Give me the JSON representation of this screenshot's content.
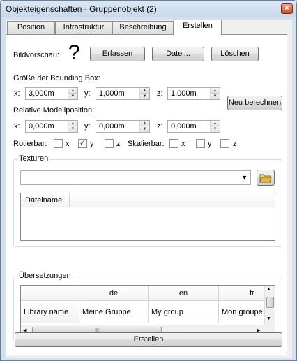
{
  "window": {
    "title": "Objekteigenschaften - Gruppenobjekt (2)",
    "close_glyph": "×"
  },
  "tabs": [
    {
      "label": "Position"
    },
    {
      "label": "Infrastruktur"
    },
    {
      "label": "Beschreibung"
    },
    {
      "label": "Erstellen",
      "active": true
    }
  ],
  "preview": {
    "label": "Bildvorschau:",
    "placeholder_glyph": "?",
    "capture_button": "Erfassen",
    "file_button": "Datei...",
    "delete_button": "Löschen"
  },
  "bounding_box": {
    "label": "Größe der Bounding Box:",
    "x_label": "x:",
    "x_value": "3,000m",
    "y_label": "y:",
    "y_value": "1,000m",
    "z_label": "z:",
    "z_value": "1,000m",
    "recalc_button": "Neu berechnen"
  },
  "model_position": {
    "label": "Relative Modellposition:",
    "x_label": "x:",
    "x_value": "0,000m",
    "y_label": "y:",
    "y_value": "0,000m",
    "z_label": "z:",
    "z_value": "0,000m"
  },
  "rotation": {
    "label": "Rotierbar:",
    "x": {
      "label": "x",
      "checked": false
    },
    "y": {
      "label": "y",
      "checked": true
    },
    "z": {
      "label": "z",
      "checked": false
    }
  },
  "scaling": {
    "label": "Skalierbar:",
    "x": {
      "label": "x",
      "checked": false
    },
    "y": {
      "label": "y",
      "checked": false
    },
    "z": {
      "label": "z",
      "checked": false
    }
  },
  "check_glyph": "✓",
  "textures": {
    "group_title": "Texturen",
    "combo_value": "",
    "dropdown_glyph": "▼",
    "columns": [
      "Dateiname"
    ]
  },
  "translations": {
    "group_title": "Übersetzungen",
    "columns": [
      "",
      "de",
      "en",
      "fr"
    ],
    "rows": [
      [
        "Library name",
        "Meine Gruppe",
        "My group",
        "Mon groupe"
      ]
    ],
    "scroll_thumb_glyph": "III"
  },
  "create_button": "Erstellen",
  "colors": {
    "title_bar": "#c8d7ea",
    "close_button": "#c74a2b",
    "folder_icon": "#e3b640"
  }
}
